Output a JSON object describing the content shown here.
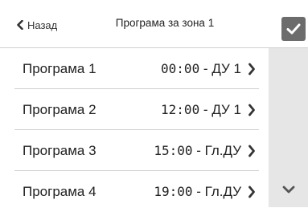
{
  "header": {
    "back_label": "Назад",
    "title": "Програма за зона 1"
  },
  "programs": [
    {
      "name": "Програма 1",
      "time": "00:00",
      "mode": "ДУ 1"
    },
    {
      "name": "Програма 2",
      "time": "12:00",
      "mode": "ДУ 1"
    },
    {
      "name": "Програма 3",
      "time": "15:00",
      "mode": "Гл.ДУ"
    },
    {
      "name": "Програма 4",
      "time": "19:00",
      "mode": "Гл.ДУ"
    }
  ],
  "icons": {
    "back": "chevron-left-icon",
    "confirm": "check-icon",
    "row": "chevron-right-icon",
    "scroll": "chevron-down-icon"
  },
  "colors": {
    "confirm_bg": "#6c6c6c",
    "scrollbar_bg": "#e6e6e6",
    "divider": "#cfcfcf"
  }
}
